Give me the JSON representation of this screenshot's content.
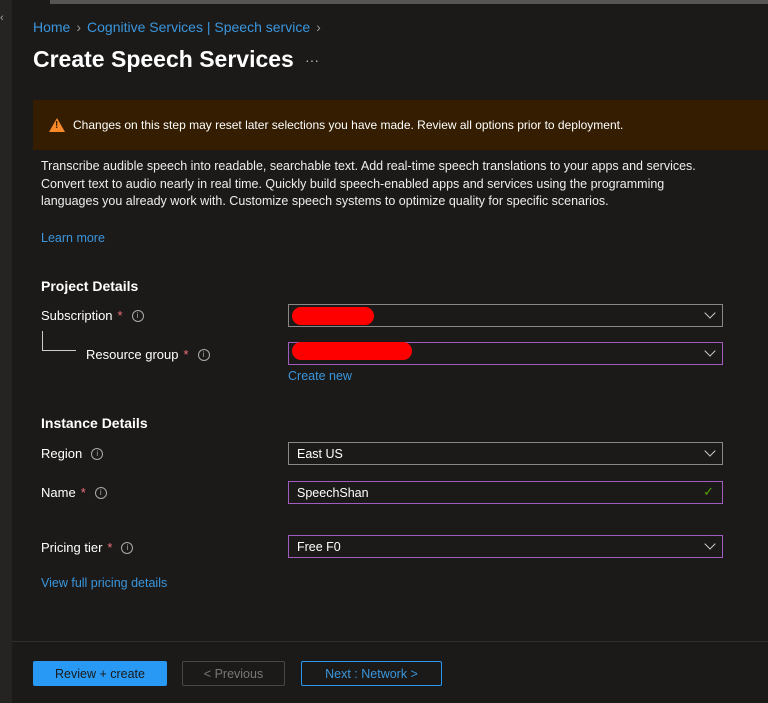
{
  "breadcrumb": {
    "items": [
      "Home",
      "Cognitive Services | Speech service"
    ]
  },
  "page_title": "Create Speech Services",
  "more": "···",
  "warning": "Changes on this step may reset later selections you have made. Review all options prior to deployment.",
  "description": "Transcribe audible speech into readable, searchable text. Add real-time speech translations to your apps and services. Convert text to audio nearly in real time. Quickly build speech-enabled apps and services using the programming languages you already work with. Customize speech systems to optimize quality for specific scenarios.",
  "learn_more": "Learn more",
  "project": {
    "heading": "Project Details",
    "subscription_label": "Subscription",
    "resource_group_label": "Resource group",
    "create_new": "Create new"
  },
  "instance": {
    "heading": "Instance Details",
    "region_label": "Region",
    "region_value": "East US",
    "name_label": "Name",
    "name_value": "SpeechShan",
    "pricing_label": "Pricing tier",
    "pricing_value": "Free F0",
    "pricing_link": "View full pricing details"
  },
  "required_mark": "*",
  "info_glyph": "i",
  "footer": {
    "review": "Review + create",
    "previous": "< Previous",
    "next": "Next : Network >"
  },
  "colors": {
    "accent": "#3a96dd",
    "warning_bg": "#341d00",
    "primary_button": "#2899f5"
  }
}
